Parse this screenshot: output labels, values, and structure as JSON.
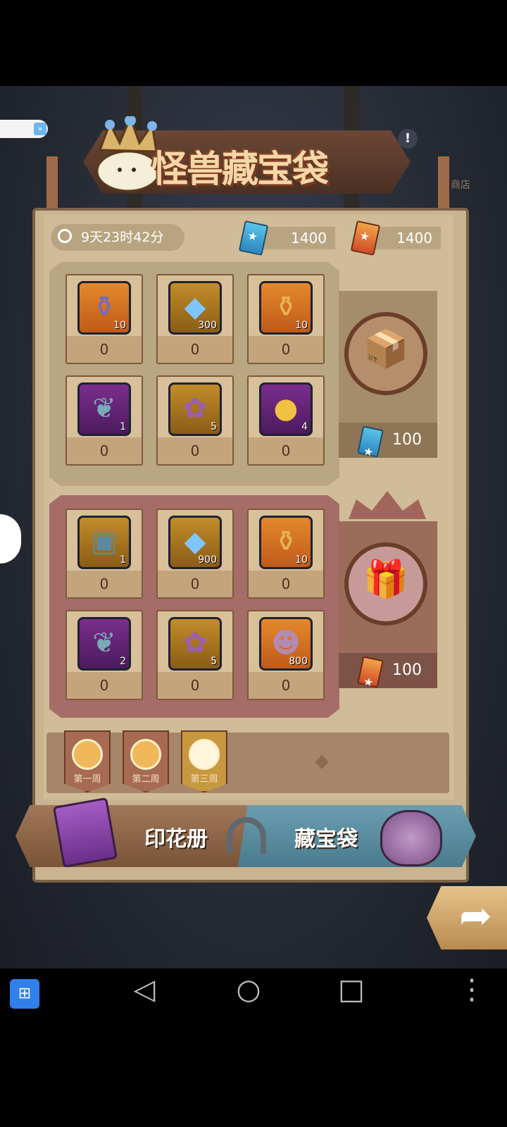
{
  "title": {
    "text": "怪兽藏宝袋",
    "info": "!"
  },
  "background": {
    "shop_label": "商店"
  },
  "timer": {
    "text": "9天23时42分"
  },
  "currency": [
    {
      "name": "blue-ticket",
      "value": "1400"
    },
    {
      "name": "orange-ticket",
      "value": "1400"
    }
  ],
  "pool_a": {
    "items": [
      {
        "icon": "vase-icon",
        "qty": "10",
        "count": "0"
      },
      {
        "icon": "crystal-icon",
        "qty": "300",
        "count": "0"
      },
      {
        "icon": "golden-urn-icon",
        "qty": "10",
        "count": "0"
      },
      {
        "icon": "leaf-icon",
        "qty": "1",
        "count": "0"
      },
      {
        "icon": "cat-bag-icon",
        "qty": "5",
        "count": "0"
      },
      {
        "icon": "gold-coins-icon",
        "qty": "4",
        "count": "0"
      }
    ],
    "box": {
      "price": "100"
    }
  },
  "pool_b": {
    "items": [
      {
        "icon": "portrait-card-icon",
        "qty": "1",
        "count": "0"
      },
      {
        "icon": "crystal-icon",
        "qty": "900",
        "count": "0"
      },
      {
        "icon": "golden-urn-icon",
        "qty": "10",
        "count": "0"
      },
      {
        "icon": "leaf-icon",
        "qty": "2",
        "count": "0"
      },
      {
        "icon": "cat-bag-icon",
        "qty": "5",
        "count": "0"
      },
      {
        "icon": "monster-head-icon",
        "qty": "800",
        "count": "0"
      }
    ],
    "box": {
      "price": "100"
    }
  },
  "weeks": [
    {
      "label": "第一周",
      "active": false
    },
    {
      "label": "第二周",
      "active": false
    },
    {
      "label": "第三周",
      "active": true
    }
  ],
  "tabs": {
    "left": "印花册",
    "right": "藏宝袋"
  },
  "colors": {
    "board": "#c9b491",
    "pool_b": "#a56c68",
    "accent_gold": "#c89840"
  }
}
